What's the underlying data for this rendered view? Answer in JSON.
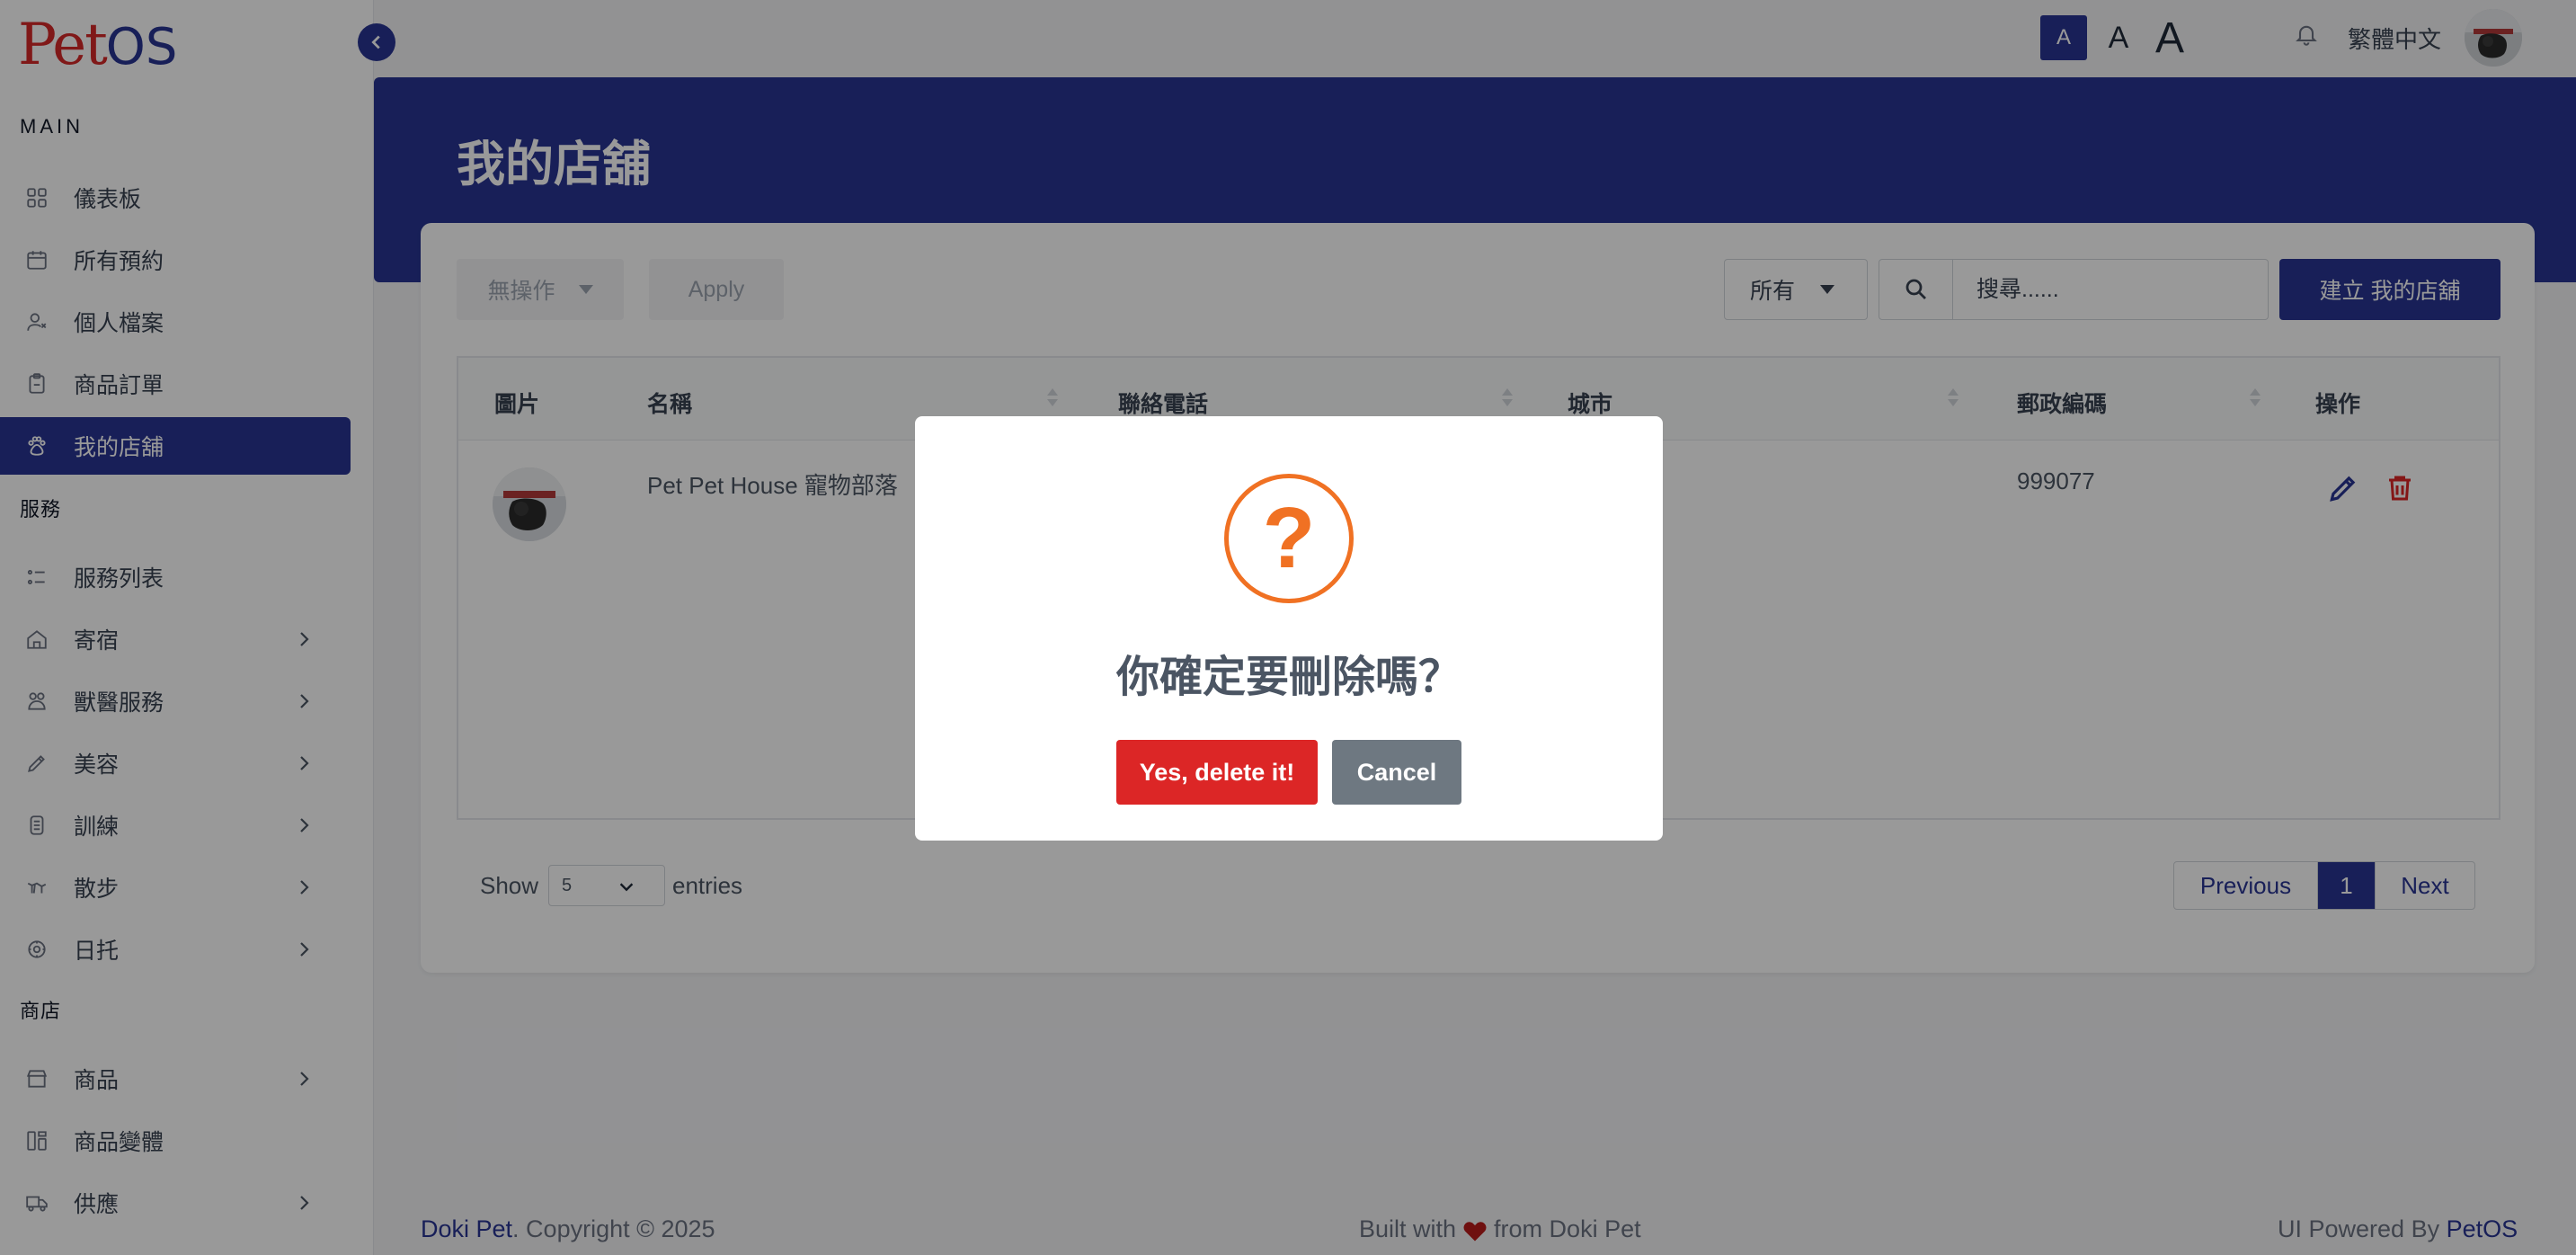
{
  "app": {
    "logo_text_a": "Pet",
    "logo_text_b": "OS"
  },
  "sidebar": {
    "section_main": "MAIN",
    "section_service": "服務",
    "section_shop": "商店",
    "items": [
      {
        "label": "儀表板",
        "icon": "dashboard-icon"
      },
      {
        "label": "所有預約",
        "icon": "calendar-icon"
      },
      {
        "label": "個人檔案",
        "icon": "user-icon"
      },
      {
        "label": "商品訂單",
        "icon": "clipboard-icon"
      },
      {
        "label": "我的店舖",
        "icon": "paw-icon",
        "active": true
      },
      {
        "label": "服務列表",
        "icon": "list-icon"
      },
      {
        "label": "寄宿",
        "icon": "home-icon"
      },
      {
        "label": "獸醫服務",
        "icon": "vet-icon"
      },
      {
        "label": "美容",
        "icon": "brush-icon"
      },
      {
        "label": "訓練",
        "icon": "training-icon"
      },
      {
        "label": "散步",
        "icon": "walk-icon"
      },
      {
        "label": "日托",
        "icon": "daycare-icon"
      },
      {
        "label": "商品",
        "icon": "store-icon"
      },
      {
        "label": "商品變體",
        "icon": "variants-icon"
      },
      {
        "label": "供應",
        "icon": "truck-icon"
      }
    ]
  },
  "header": {
    "font_small": "A",
    "font_medium": "A",
    "font_large": "A",
    "language": "繁體中文"
  },
  "page": {
    "title": "我的店舖",
    "bulk_action": "無操作",
    "apply_label": "Apply",
    "filter_value": "所有",
    "search_placeholder": "搜尋......",
    "create_label": "建立 我的店舖"
  },
  "table": {
    "columns": [
      "圖片",
      "名稱",
      "聯絡電話",
      "城市",
      "郵政編碼",
      "操作"
    ],
    "rows": [
      {
        "name": "Pet Pet House 寵物部落",
        "phone": "",
        "city": "",
        "postal_code": "999077"
      }
    ]
  },
  "pagination": {
    "show_label": "Show",
    "entries_value": "5",
    "entries_label": "entries",
    "previous": "Previous",
    "current_page": "1",
    "next": "Next"
  },
  "footer": {
    "brand": "Doki Pet",
    "copyright": ". Copyright © 2025",
    "built_with": "Built with",
    "from": "from Doki Pet",
    "powered_by": "UI Powered By",
    "powered_brand": "PetOS"
  },
  "dialog": {
    "icon": "question-icon",
    "title": "你確定要刪除嗎？",
    "confirm_label": "Yes, delete it!",
    "cancel_label": "Cancel"
  },
  "colors": {
    "primary": "#283593",
    "danger": "#dc2626",
    "warning": "#f07123",
    "cancel": "#6e7881"
  }
}
